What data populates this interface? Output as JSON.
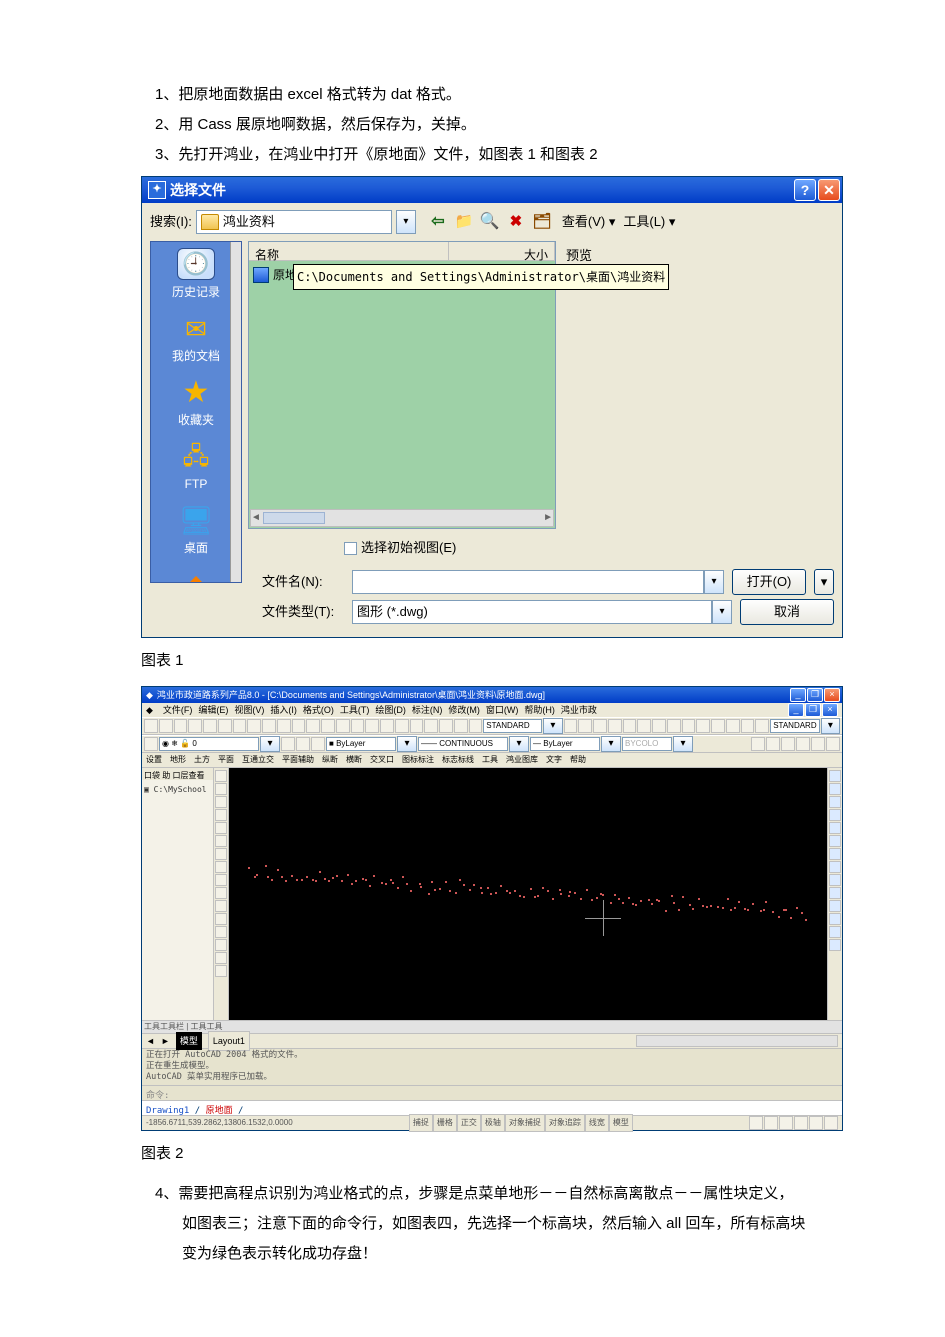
{
  "steps": {
    "s1_num": "1、",
    "s1": "把原地面数据由 excel 格式转为 dat 格式。",
    "s2_num": "2、",
    "s2": "用 Cass 展原地啊数据，然后保存为，关掉。",
    "s3_num": "3、",
    "s3": "先打开鸿业，在鸿业中打开《原地面》文件，如图表 1 和图表 2",
    "s4_num": "4、",
    "s4a": "需要把高程点识别为鸿业格式的点，步骤是点菜单地形－－自然标高离散点－－属性块定义，",
    "s4b": "如图表三；注意下面的命令行，如图表四，先选择一个标高块，然后输入 all 回车，所有标高块",
    "s4c": "变为绿色表示转化成功存盘！"
  },
  "captions": {
    "c1": "图表 1",
    "c2": "图表 2"
  },
  "dialog": {
    "title": "选择文件",
    "search_label": "搜索(I):",
    "folder": "鸿业资料",
    "view_btn": "查看(V)",
    "tools_btn": "工具(L)",
    "col_name": "名称",
    "col_size": "大小",
    "file_prefix": "原地",
    "tooltip": "C:\\Documents and Settings\\Administrator\\桌面\\鸿业资料",
    "preview": "预览",
    "checkbox": "选择初始视图(E)",
    "fname_label": "文件名(N):",
    "ftype_label": "文件类型(T):",
    "ftype_value": "图形 (*.dwg)",
    "open_btn": "打开(O)",
    "cancel_btn": "取消",
    "places": {
      "history": "历史记录",
      "docs": "我的文档",
      "fav": "收藏夹",
      "ftp": "FTP",
      "desktop": "桌面"
    }
  },
  "app": {
    "title": "鸿业市政道路系列产品8.0 - [C:\\Documents and Settings\\Administrator\\桌面\\鸿业资料\\原地面.dwg]",
    "menu": [
      "文件(F)",
      "编辑(E)",
      "视图(V)",
      "插入(I)",
      "格式(O)",
      "工具(T)",
      "绘图(D)",
      "标注(N)",
      "修改(M)",
      "窗口(W)",
      "帮助(H)",
      "鸿业市政"
    ],
    "menu2": [
      "设置",
      "地形",
      "土方",
      "平面",
      "互通立交",
      "平面辅助",
      "纵断",
      "横断",
      "交叉口",
      "图标标注",
      "标志标线",
      "工具",
      "鸿业图库",
      "文字",
      "帮助"
    ],
    "layer": "0",
    "color": "ByLayer",
    "linetype": "CONTINUOUS",
    "lineweight": "ByLayer",
    "style1": "STANDARD",
    "style2": "STANDARD",
    "wblock": "BYCOLO",
    "leftpanel": {
      "tabs": "口袋 助 口层查看",
      "tree_root": "C:\\MySchool"
    },
    "sheet_tabs": [
      "模型",
      "Layout1"
    ],
    "left_bottom_tabs": [
      "工具工具栏",
      "工具工具"
    ],
    "cmd_lines": [
      "正在打开 AutoCAD 2004 格式的文件。",
      "正在重生成模型。",
      "AutoCAD 菜单实用程序已加载。"
    ],
    "cmd_prompt": "命令:",
    "doc_tabs": [
      "Drawing1",
      "原地面"
    ],
    "status_left": "-1856.6711,539.2862,13806.1532,0.0000",
    "status_modes": [
      "捕捉",
      "栅格",
      "正交",
      "极轴",
      "对象捕捉",
      "对象追踪",
      "线宽",
      "模型"
    ]
  }
}
